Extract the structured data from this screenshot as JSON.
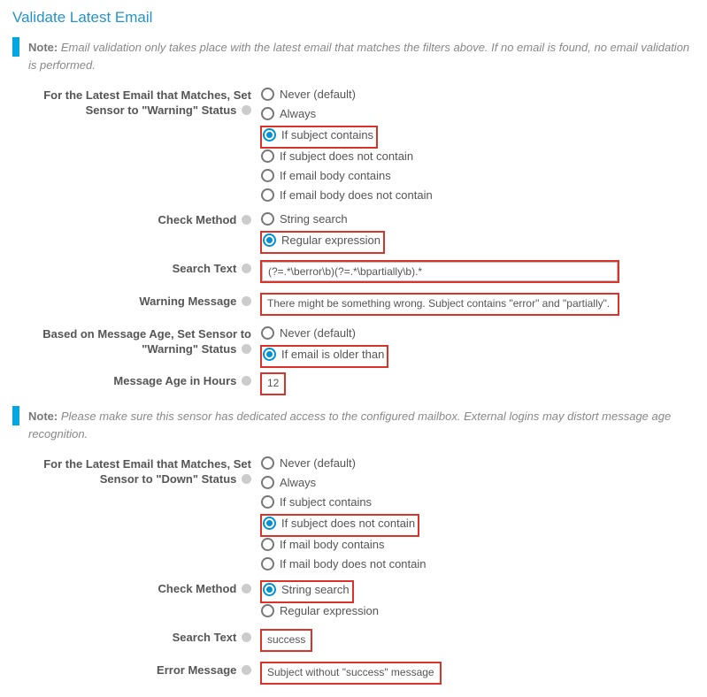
{
  "title": "Validate Latest Email",
  "note1_label": "Note:",
  "note1_text": "Email validation only takes place with the latest email that matches the filters above. If no email is found, no email validation is performed.",
  "note2_label": "Note:",
  "note2_text": "Please make sure this sensor has dedicated access to the configured mailbox. External logins may distort message age recognition.",
  "warning_status": {
    "label": "For the Latest Email that Matches, Set Sensor to \"Warning\" Status",
    "options": [
      {
        "label": "Never (default)",
        "checked": false,
        "hl": false
      },
      {
        "label": "Always",
        "checked": false,
        "hl": false
      },
      {
        "label": "If subject contains",
        "checked": true,
        "hl": true
      },
      {
        "label": "If subject does not contain",
        "checked": false,
        "hl": false
      },
      {
        "label": "If email body contains",
        "checked": false,
        "hl": false
      },
      {
        "label": "If email body does not contain",
        "checked": false,
        "hl": false
      }
    ]
  },
  "check_method_1": {
    "label": "Check Method",
    "options": [
      {
        "label": "String search",
        "checked": false,
        "hl": false
      },
      {
        "label": "Regular expression",
        "checked": true,
        "hl": true
      }
    ]
  },
  "search_text_1": {
    "label": "Search Text",
    "value": "(?=.*\\berror\\b)(?=.*\\bpartially\\b).*"
  },
  "warning_message": {
    "label": "Warning Message",
    "value": "There might be something wrong. Subject contains \"error\" and \"partially\"."
  },
  "age_warning": {
    "label": "Based on Message Age, Set Sensor to \"Warning\" Status",
    "options": [
      {
        "label": "Never (default)",
        "checked": false,
        "hl": false
      },
      {
        "label": "If email is older than",
        "checked": true,
        "hl": true
      }
    ]
  },
  "age_hours": {
    "label": "Message Age in Hours",
    "value": "12"
  },
  "down_status": {
    "label": "For the Latest Email that Matches, Set Sensor to \"Down\" Status",
    "options": [
      {
        "label": "Never (default)",
        "checked": false,
        "hl": false
      },
      {
        "label": "Always",
        "checked": false,
        "hl": false
      },
      {
        "label": "If subject contains",
        "checked": false,
        "hl": false
      },
      {
        "label": "If subject does not contain",
        "checked": true,
        "hl": true
      },
      {
        "label": "If mail body contains",
        "checked": false,
        "hl": false
      },
      {
        "label": "If mail body does not contain",
        "checked": false,
        "hl": false
      }
    ]
  },
  "check_method_2": {
    "label": "Check Method",
    "options": [
      {
        "label": "String search",
        "checked": true,
        "hl": true
      },
      {
        "label": "Regular expression",
        "checked": false,
        "hl": false
      }
    ]
  },
  "search_text_2": {
    "label": "Search Text",
    "value": "success"
  },
  "error_message": {
    "label": "Error Message",
    "value": "Subject without \"success\" message"
  }
}
